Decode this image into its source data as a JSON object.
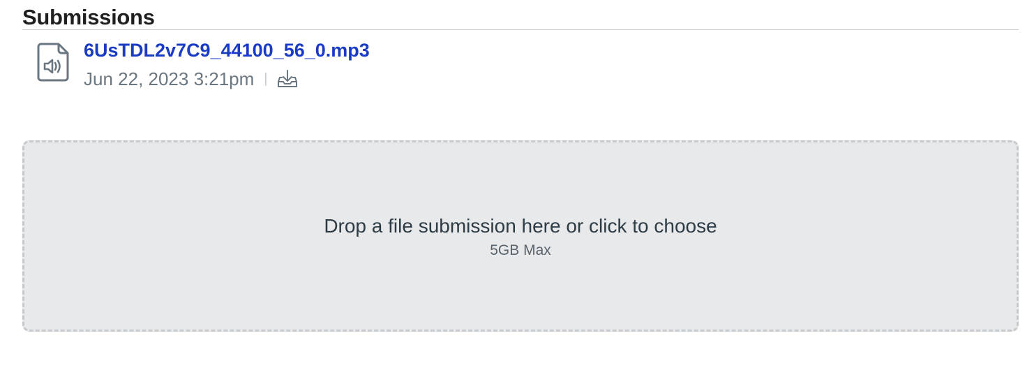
{
  "header": {
    "title": "Submissions"
  },
  "submissions": [
    {
      "icon": "audio-file-icon",
      "filename": "6UsTDL2v7C9_44100_56_0.mp3",
      "date": "Jun 22, 2023 3:21pm",
      "separator": "|",
      "download_icon": "download-icon"
    }
  ],
  "dropzone": {
    "primary_text": "Drop a file submission here or click to choose",
    "secondary_text": "5GB Max"
  },
  "colors": {
    "link": "#1a3cc4",
    "muted_text": "#6b7780",
    "dropzone_bg": "#e8e9ea",
    "dropzone_border": "#c7cacd",
    "icon": "#6b7780"
  }
}
